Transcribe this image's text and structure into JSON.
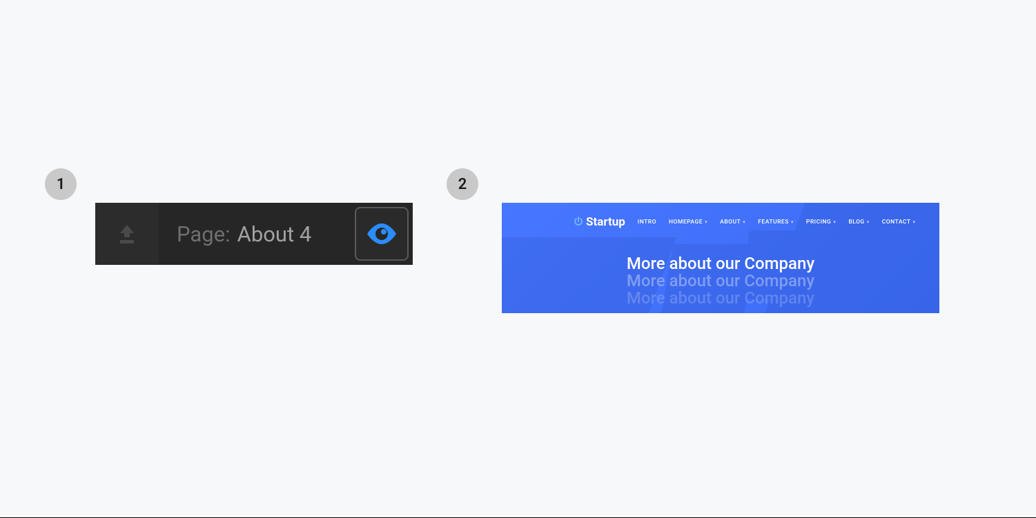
{
  "steps": {
    "one": "1",
    "two": "2"
  },
  "toolbar": {
    "page_label": "Page:",
    "page_name": "About 4"
  },
  "site": {
    "logo_text": "Startup",
    "nav": [
      {
        "label": "INTRO",
        "dropdown": false
      },
      {
        "label": "HOMEPAGE",
        "dropdown": true
      },
      {
        "label": "ABOUT",
        "dropdown": true
      },
      {
        "label": "FEATURES",
        "dropdown": true
      },
      {
        "label": "PRICING",
        "dropdown": true
      },
      {
        "label": "BLOG",
        "dropdown": true
      },
      {
        "label": "CONTACT",
        "dropdown": true
      }
    ],
    "hero_heading": "More about our Company"
  }
}
